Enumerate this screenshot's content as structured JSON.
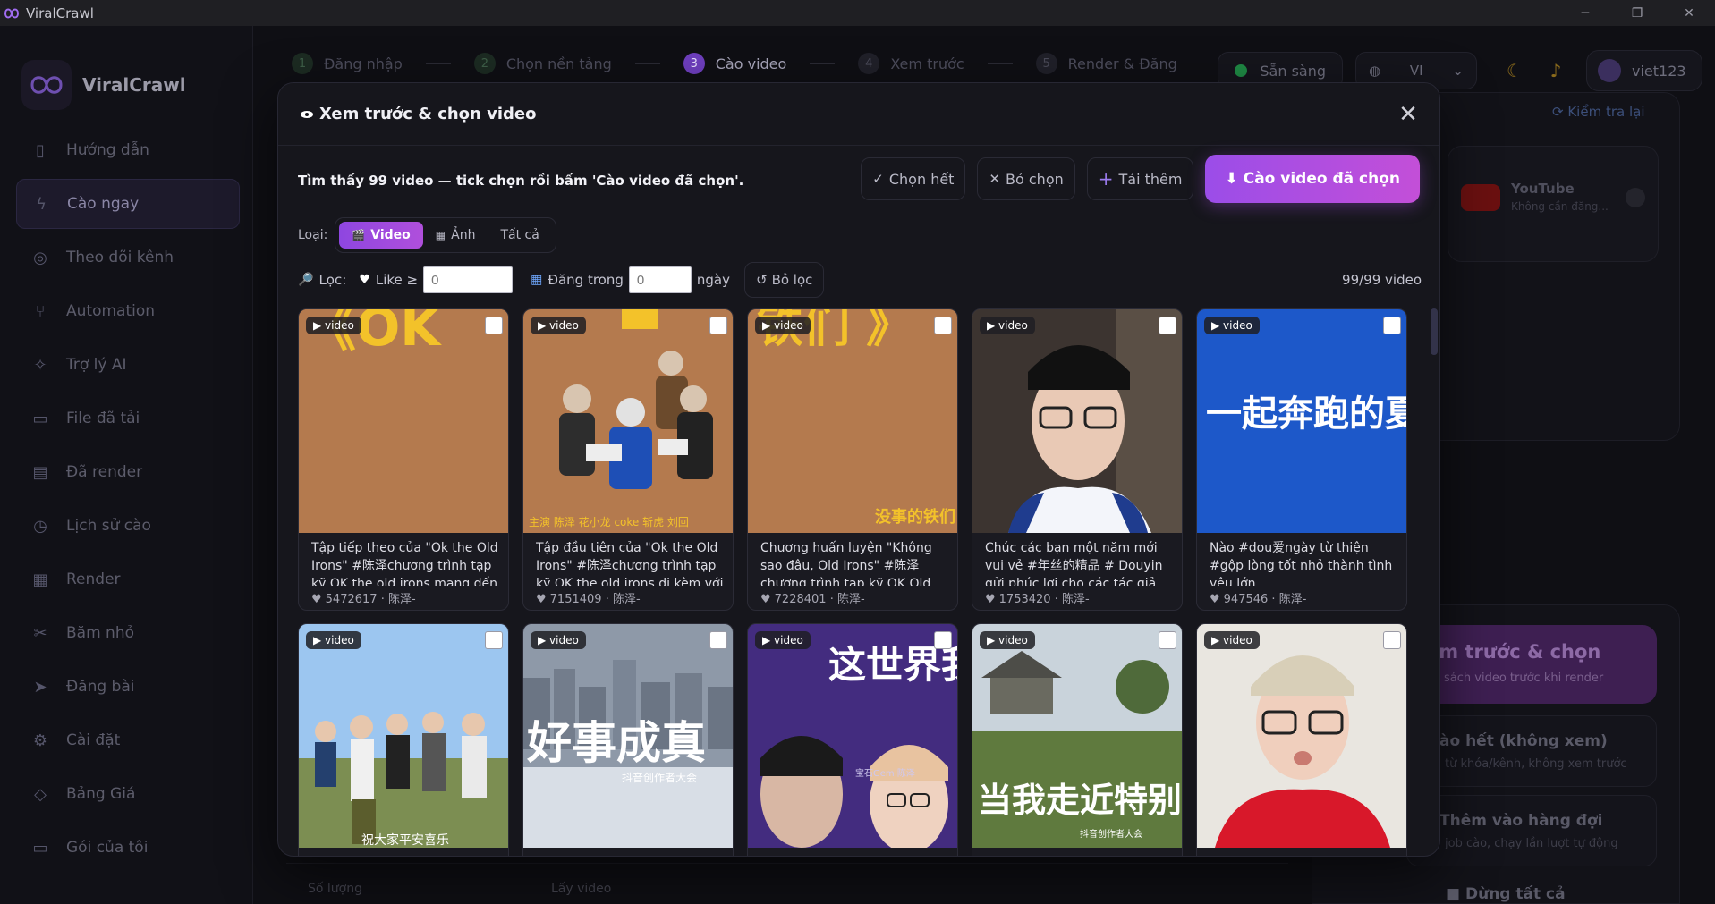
{
  "window": {
    "title": "ViralCrawl",
    "controls": [
      "─",
      "❐",
      "✕"
    ]
  },
  "sidebar": {
    "brand": "ViralCrawl",
    "items": [
      {
        "label": "Hướng dẫn",
        "icon": "book-icon"
      },
      {
        "label": "Cào ngay",
        "icon": "lightning-icon",
        "active": true
      },
      {
        "label": "Theo dõi kênh",
        "icon": "play-circle-icon"
      },
      {
        "label": "Automation",
        "icon": "branch-icon"
      },
      {
        "label": "Trợ lý AI",
        "icon": "sparkle-icon"
      },
      {
        "label": "File đã tải",
        "icon": "folder-icon"
      },
      {
        "label": "Đã render",
        "icon": "calendar-icon"
      },
      {
        "label": "Lịch sử cào",
        "icon": "clock-icon"
      },
      {
        "label": "Render",
        "icon": "film-icon"
      },
      {
        "label": "Băm nhỏ",
        "icon": "scissors-icon"
      },
      {
        "label": "Đăng bài",
        "icon": "send-icon"
      },
      {
        "label": "Cài đặt",
        "icon": "gear-icon"
      },
      {
        "label": "Bảng Giá",
        "icon": "tag-icon"
      },
      {
        "label": "Gói của tôi",
        "icon": "card-icon"
      }
    ]
  },
  "header": {
    "steps": [
      {
        "num": "1",
        "label": "Đăng nhập"
      },
      {
        "num": "2",
        "label": "Chọn nền tảng"
      },
      {
        "num": "3",
        "label": "Cào video"
      },
      {
        "num": "4",
        "label": "Xem trước"
      },
      {
        "num": "5",
        "label": "Render & Đăng"
      }
    ],
    "status": "Sẵn sàng",
    "language": "VI",
    "username": "viet123"
  },
  "background": {
    "recheck": "Kiểm tra lại",
    "platform_name": "YouTube",
    "platform_status": "Không cần đăng...",
    "preview_btn_title": "em trước & chọn",
    "preview_btn_sub": "sách video trước khi render",
    "opt1_title": "ào hết (không xem)",
    "opt1_sub": "từ khóa/kênh, không xem trước",
    "opt2_title": "Thêm vào hàng đợi",
    "opt2_sub": "job cào, chạy lần lượt tự động",
    "stop_all": "■ Dừng tất cả",
    "bottom_a": "Số lượng",
    "bottom_b": "Lấy video"
  },
  "modal": {
    "title": "Xem trước & chọn video",
    "summary": "Tìm thấy 99 video — tick chọn rồi bấm 'Cào video đã chọn'.",
    "select_all": "Chọn hết",
    "deselect": "Bỏ chọn",
    "load_more": "Tải thêm",
    "crawl_selected": "Cào video đã chọn",
    "type_label": "Loại:",
    "types": [
      {
        "label": "Video",
        "icon": "🎬"
      },
      {
        "label": "Ảnh",
        "icon": "▦"
      },
      {
        "label": "Tất cả",
        "icon": ""
      }
    ],
    "filter_label": "Lọc:",
    "like_label": "Like ≥",
    "like_value": "0",
    "posted_label": "Đăng trong",
    "posted_value": "0",
    "days_label": "ngày",
    "reset_filter": "Bỏ lọc",
    "count": "99/99 video",
    "badge": "▶ video",
    "videos": [
      {
        "caption": "Tập tiếp theo của \"Ok the Old Irons\" #陈泽chương trình tạp kỹ OK the old irons mang đến tiếng",
        "likes": "5472617",
        "author": "陈泽-"
      },
      {
        "caption": "Tập đầu tiên của \"Ok the Old Irons\" #陈泽chương trình tạp kỹ OK the old irons đi kèm với đồn",
        "likes": "7151409",
        "author": "陈泽-"
      },
      {
        "caption": "Chương huấn luyện \"Không sao đâu, Old Irons\" #陈泽chương trình tạp kỹ OK Old Irons, cuộc",
        "likes": "7228401",
        "author": "陈泽-"
      },
      {
        "caption": "Chúc các bạn một năm mới vui vẻ #年丝的精品 # Douyin gửi phúc lợi cho các tác giả được chọn",
        "likes": "1753420",
        "author": "陈泽-"
      },
      {
        "caption": "Nào #dou爱ngày từ thiện #gộp lòng tốt nhỏ thành tình yêu lớn",
        "likes": "947546",
        "author": "陈泽-"
      },
      {
        "caption": "",
        "likes": "",
        "author": ""
      },
      {
        "caption": "",
        "likes": "",
        "author": ""
      },
      {
        "caption": "",
        "likes": "",
        "author": ""
      },
      {
        "caption": "",
        "likes": "",
        "author": ""
      },
      {
        "caption": "",
        "likes": "",
        "author": ""
      }
    ],
    "thumb_text": {
      "t1": "《OK",
      "t2_credit": "主演 陈泽 花小龙 coke 斩虎 刘回",
      "t3": "铁们 》",
      "t3_logo": "没事的铁们",
      "t5": "一起奔跑的夏天",
      "t6": "祝大家平安喜乐",
      "t7": "好事成真",
      "t7_sub": "抖音创作者大会",
      "t8": "这世界我来过",
      "t8_credit": "宝石Gem 陈泽",
      "t9": "当我走近特别的你",
      "t9_sub": "抖音创作者大会"
    }
  }
}
